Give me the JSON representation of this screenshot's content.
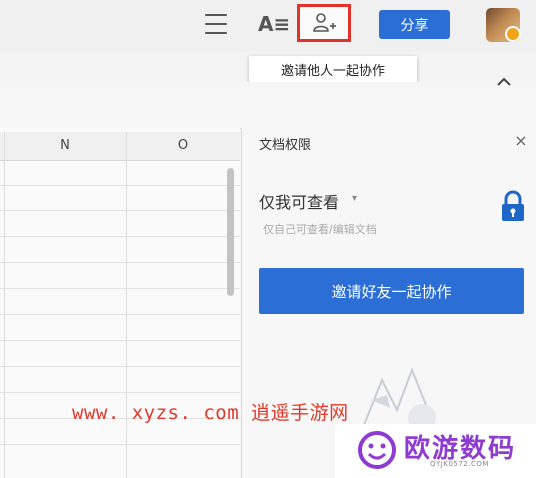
{
  "toolbar": {
    "font_icon_label": "A≡",
    "share_label": "分享",
    "invite_tooltip": "邀请他人一起协作"
  },
  "sheet": {
    "columns": [
      "N",
      "O"
    ]
  },
  "permission_panel": {
    "title": "文档权限",
    "close_label": "×",
    "level_label": "仅我可查看",
    "level_arrow": "▾",
    "description": "仅自己可查看/编辑文档",
    "invite_button_label": "邀请好友一起协作"
  },
  "watermark": {
    "url_text": "www. xyzs. com",
    "site_name": "逍遥手游网"
  },
  "logo": {
    "name": "欧游数码",
    "sub": "QYJK0572.COM"
  },
  "colors": {
    "accent_blue": "#2b6fd6",
    "highlight_red": "#e2332b",
    "watermark_red": "#e03a2c",
    "logo_purple": "#8e3bd1"
  },
  "icons": [
    "menu-icon",
    "font-icon",
    "add-user-icon",
    "avatar",
    "chevron-up-icon",
    "close-icon",
    "lock-icon"
  ]
}
